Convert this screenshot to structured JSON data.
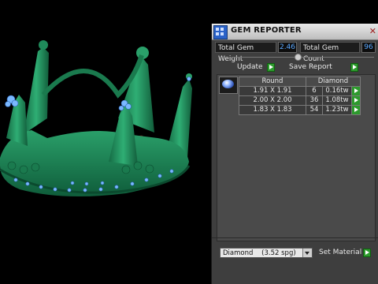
{
  "window": {
    "title": "GEM REPORTER",
    "close_glyph": "✕"
  },
  "stats": {
    "weight_label": "Total Gem Weight",
    "weight_value": "2.46",
    "count_label": "Total Gem Count",
    "count_value": "96"
  },
  "actions": {
    "update_label": "Update",
    "save_label": "Save Report"
  },
  "table": {
    "headers": [
      "Round",
      "Diamond"
    ],
    "rows": [
      {
        "size": "1.91 X 1.91",
        "count": "6",
        "weight": "0.16tw"
      },
      {
        "size": "2.00 X 2.00",
        "count": "36",
        "weight": "1.08tw"
      },
      {
        "size": "1.83 X 1.83",
        "count": "54",
        "weight": "1.23tw"
      }
    ]
  },
  "material": {
    "selected": "Diamond    (3.52 spg)",
    "set_label": "Set Material"
  },
  "colors": {
    "crown": "#1f8a5a",
    "panel": "#3e3e3e",
    "value_text": "#5aa8ff",
    "go_button": "#2d9a2d"
  }
}
